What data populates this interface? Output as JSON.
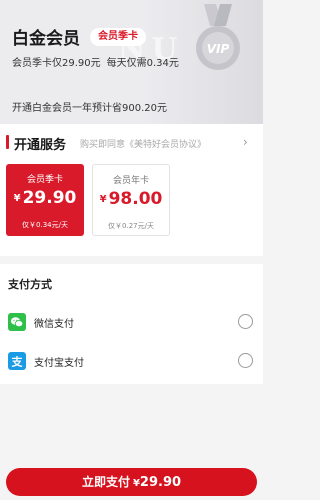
{
  "header": {
    "title": "白金会员",
    "tag": "会员季卡",
    "price_info": "会员季卡仅29.90元",
    "daily_info": "每天仅需0.34元",
    "saving_info": "开通白金会员一年预计省900.20元",
    "watermark": "NU",
    "medal_text": "VIP"
  },
  "service": {
    "title": "开通服务",
    "agreement": "购买即同意《美特好会员协议》",
    "arrow": "›",
    "plans": [
      {
        "name": "会员季卡",
        "currency": "¥",
        "price": "29.90",
        "daily": "仅￥0.34元/天",
        "selected": true
      },
      {
        "name": "会员年卡",
        "currency": "¥",
        "price": "98.00",
        "daily": "仅￥0.27元/天",
        "selected": false
      }
    ]
  },
  "payment": {
    "title": "支付方式",
    "methods": [
      {
        "label": "微信支付",
        "icon": "wechat-pay-icon"
      },
      {
        "label": "支付宝支付",
        "icon": "alipay-icon"
      }
    ]
  },
  "footer": {
    "pay_label": "立即支付",
    "currency": "¥",
    "amount": "29.90"
  },
  "colors": {
    "accent": "#d91a2a",
    "wechat": "#2fc04a",
    "alipay": "#1a9be6"
  }
}
